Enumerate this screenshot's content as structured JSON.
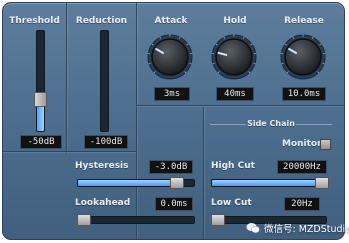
{
  "threshold": {
    "label": "Threshold",
    "value": "-50dB",
    "level": 0.32
  },
  "reduction": {
    "label": "Reduction",
    "value": "-100dB",
    "level": 0.0
  },
  "attack": {
    "label": "Attack",
    "value": "3ms"
  },
  "hold": {
    "label": "Hold",
    "value": "40ms"
  },
  "release": {
    "label": "Release",
    "value": "10.0ms"
  },
  "hysteresis": {
    "label": "Hysteresis",
    "value": "-3.0dB",
    "level": 0.88
  },
  "lookahead": {
    "label": "Lookahead",
    "value": "0.0ms",
    "level": 0.0
  },
  "side_chain": {
    "title": "Side Chain",
    "monitor_label": "Monitor",
    "high_cut": {
      "label": "High Cut",
      "value": "20000Hz",
      "level": 1.0
    },
    "low_cut": {
      "label": "Low Cut",
      "value": "20Hz",
      "level": 0.0
    }
  },
  "watermark": {
    "text": "微信号: MZDStudios"
  },
  "colors": {
    "accent": "#48a7ff",
    "panel": "#4e6f90",
    "field": "#111111"
  }
}
